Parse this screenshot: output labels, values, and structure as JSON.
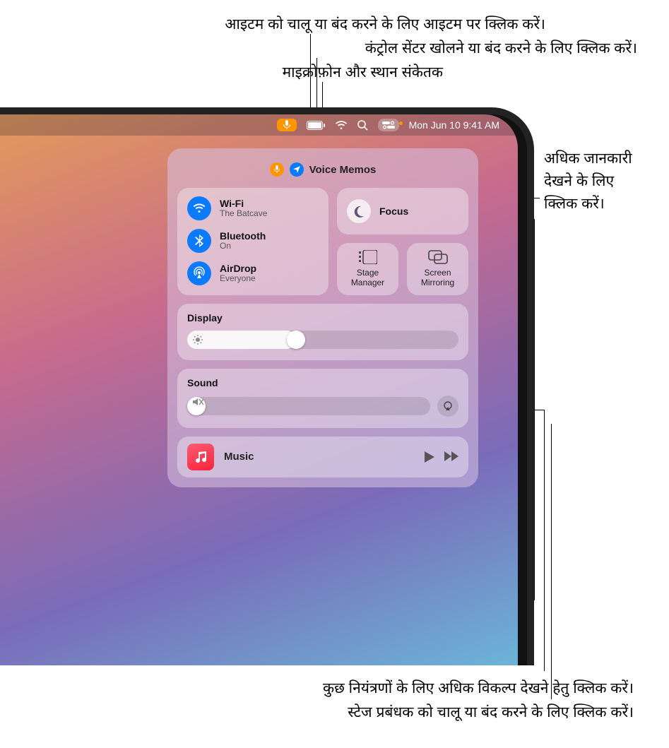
{
  "callouts": {
    "top1": "आइटम को चालू या बंद करने के लिए आइटम पर क्लिक करें।",
    "top2": "कंट्रोल सेंटर खोलने या बंद करने के लिए क्लिक करें।",
    "top3": "माइक्रोफ़ोन और स्थान संकेतक",
    "right1a": "अधिक जानकारी",
    "right1b": "देखने के लिए",
    "right1c": "क्लिक करें।",
    "bottom1": "कुछ नियंत्रणों के लिए अधिक विकल्प देखने हेतु क्लिक करें।",
    "bottom2": "स्टेज प्रबंधक को चालू या बंद करने के लिए क्लिक करें।"
  },
  "menubar": {
    "datetime": "Mon Jun 10  9:41 AM"
  },
  "active": {
    "label": "Voice Memos"
  },
  "connectivity": {
    "wifi": {
      "title": "Wi-Fi",
      "sub": "The Batcave"
    },
    "bluetooth": {
      "title": "Bluetooth",
      "sub": "On"
    },
    "airdrop": {
      "title": "AirDrop",
      "sub": "Everyone"
    }
  },
  "focus": {
    "title": "Focus"
  },
  "stage": {
    "label": "Stage Manager"
  },
  "mirror": {
    "label": "Screen Mirroring"
  },
  "display": {
    "label": "Display",
    "value": 40
  },
  "sound": {
    "label": "Sound",
    "value": 0
  },
  "music": {
    "title": "Music"
  }
}
